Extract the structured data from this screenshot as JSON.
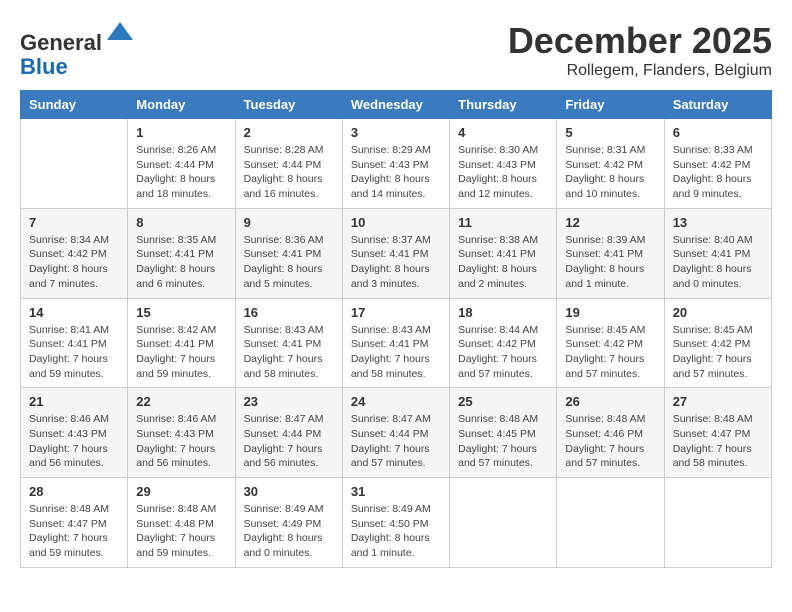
{
  "header": {
    "logo_general": "General",
    "logo_blue": "Blue",
    "main_title": "December 2025",
    "subtitle": "Rollegem, Flanders, Belgium"
  },
  "calendar": {
    "days_of_week": [
      "Sunday",
      "Monday",
      "Tuesday",
      "Wednesday",
      "Thursday",
      "Friday",
      "Saturday"
    ],
    "weeks": [
      [
        {
          "day": "",
          "info": ""
        },
        {
          "day": "1",
          "info": "Sunrise: 8:26 AM\nSunset: 4:44 PM\nDaylight: 8 hours and 18 minutes."
        },
        {
          "day": "2",
          "info": "Sunrise: 8:28 AM\nSunset: 4:44 PM\nDaylight: 8 hours and 16 minutes."
        },
        {
          "day": "3",
          "info": "Sunrise: 8:29 AM\nSunset: 4:43 PM\nDaylight: 8 hours and 14 minutes."
        },
        {
          "day": "4",
          "info": "Sunrise: 8:30 AM\nSunset: 4:43 PM\nDaylight: 8 hours and 12 minutes."
        },
        {
          "day": "5",
          "info": "Sunrise: 8:31 AM\nSunset: 4:42 PM\nDaylight: 8 hours and 10 minutes."
        },
        {
          "day": "6",
          "info": "Sunrise: 8:33 AM\nSunset: 4:42 PM\nDaylight: 8 hours and 9 minutes."
        }
      ],
      [
        {
          "day": "7",
          "info": "Sunrise: 8:34 AM\nSunset: 4:42 PM\nDaylight: 8 hours and 7 minutes."
        },
        {
          "day": "8",
          "info": "Sunrise: 8:35 AM\nSunset: 4:41 PM\nDaylight: 8 hours and 6 minutes."
        },
        {
          "day": "9",
          "info": "Sunrise: 8:36 AM\nSunset: 4:41 PM\nDaylight: 8 hours and 5 minutes."
        },
        {
          "day": "10",
          "info": "Sunrise: 8:37 AM\nSunset: 4:41 PM\nDaylight: 8 hours and 3 minutes."
        },
        {
          "day": "11",
          "info": "Sunrise: 8:38 AM\nSunset: 4:41 PM\nDaylight: 8 hours and 2 minutes."
        },
        {
          "day": "12",
          "info": "Sunrise: 8:39 AM\nSunset: 4:41 PM\nDaylight: 8 hours and 1 minute."
        },
        {
          "day": "13",
          "info": "Sunrise: 8:40 AM\nSunset: 4:41 PM\nDaylight: 8 hours and 0 minutes."
        }
      ],
      [
        {
          "day": "14",
          "info": "Sunrise: 8:41 AM\nSunset: 4:41 PM\nDaylight: 7 hours and 59 minutes."
        },
        {
          "day": "15",
          "info": "Sunrise: 8:42 AM\nSunset: 4:41 PM\nDaylight: 7 hours and 59 minutes."
        },
        {
          "day": "16",
          "info": "Sunrise: 8:43 AM\nSunset: 4:41 PM\nDaylight: 7 hours and 58 minutes."
        },
        {
          "day": "17",
          "info": "Sunrise: 8:43 AM\nSunset: 4:41 PM\nDaylight: 7 hours and 58 minutes."
        },
        {
          "day": "18",
          "info": "Sunrise: 8:44 AM\nSunset: 4:42 PM\nDaylight: 7 hours and 57 minutes."
        },
        {
          "day": "19",
          "info": "Sunrise: 8:45 AM\nSunset: 4:42 PM\nDaylight: 7 hours and 57 minutes."
        },
        {
          "day": "20",
          "info": "Sunrise: 8:45 AM\nSunset: 4:42 PM\nDaylight: 7 hours and 57 minutes."
        }
      ],
      [
        {
          "day": "21",
          "info": "Sunrise: 8:46 AM\nSunset: 4:43 PM\nDaylight: 7 hours and 56 minutes."
        },
        {
          "day": "22",
          "info": "Sunrise: 8:46 AM\nSunset: 4:43 PM\nDaylight: 7 hours and 56 minutes."
        },
        {
          "day": "23",
          "info": "Sunrise: 8:47 AM\nSunset: 4:44 PM\nDaylight: 7 hours and 56 minutes."
        },
        {
          "day": "24",
          "info": "Sunrise: 8:47 AM\nSunset: 4:44 PM\nDaylight: 7 hours and 57 minutes."
        },
        {
          "day": "25",
          "info": "Sunrise: 8:48 AM\nSunset: 4:45 PM\nDaylight: 7 hours and 57 minutes."
        },
        {
          "day": "26",
          "info": "Sunrise: 8:48 AM\nSunset: 4:46 PM\nDaylight: 7 hours and 57 minutes."
        },
        {
          "day": "27",
          "info": "Sunrise: 8:48 AM\nSunset: 4:47 PM\nDaylight: 7 hours and 58 minutes."
        }
      ],
      [
        {
          "day": "28",
          "info": "Sunrise: 8:48 AM\nSunset: 4:47 PM\nDaylight: 7 hours and 59 minutes."
        },
        {
          "day": "29",
          "info": "Sunrise: 8:48 AM\nSunset: 4:48 PM\nDaylight: 7 hours and 59 minutes."
        },
        {
          "day": "30",
          "info": "Sunrise: 8:49 AM\nSunset: 4:49 PM\nDaylight: 8 hours and 0 minutes."
        },
        {
          "day": "31",
          "info": "Sunrise: 8:49 AM\nSunset: 4:50 PM\nDaylight: 8 hours and 1 minute."
        },
        {
          "day": "",
          "info": ""
        },
        {
          "day": "",
          "info": ""
        },
        {
          "day": "",
          "info": ""
        }
      ]
    ]
  }
}
